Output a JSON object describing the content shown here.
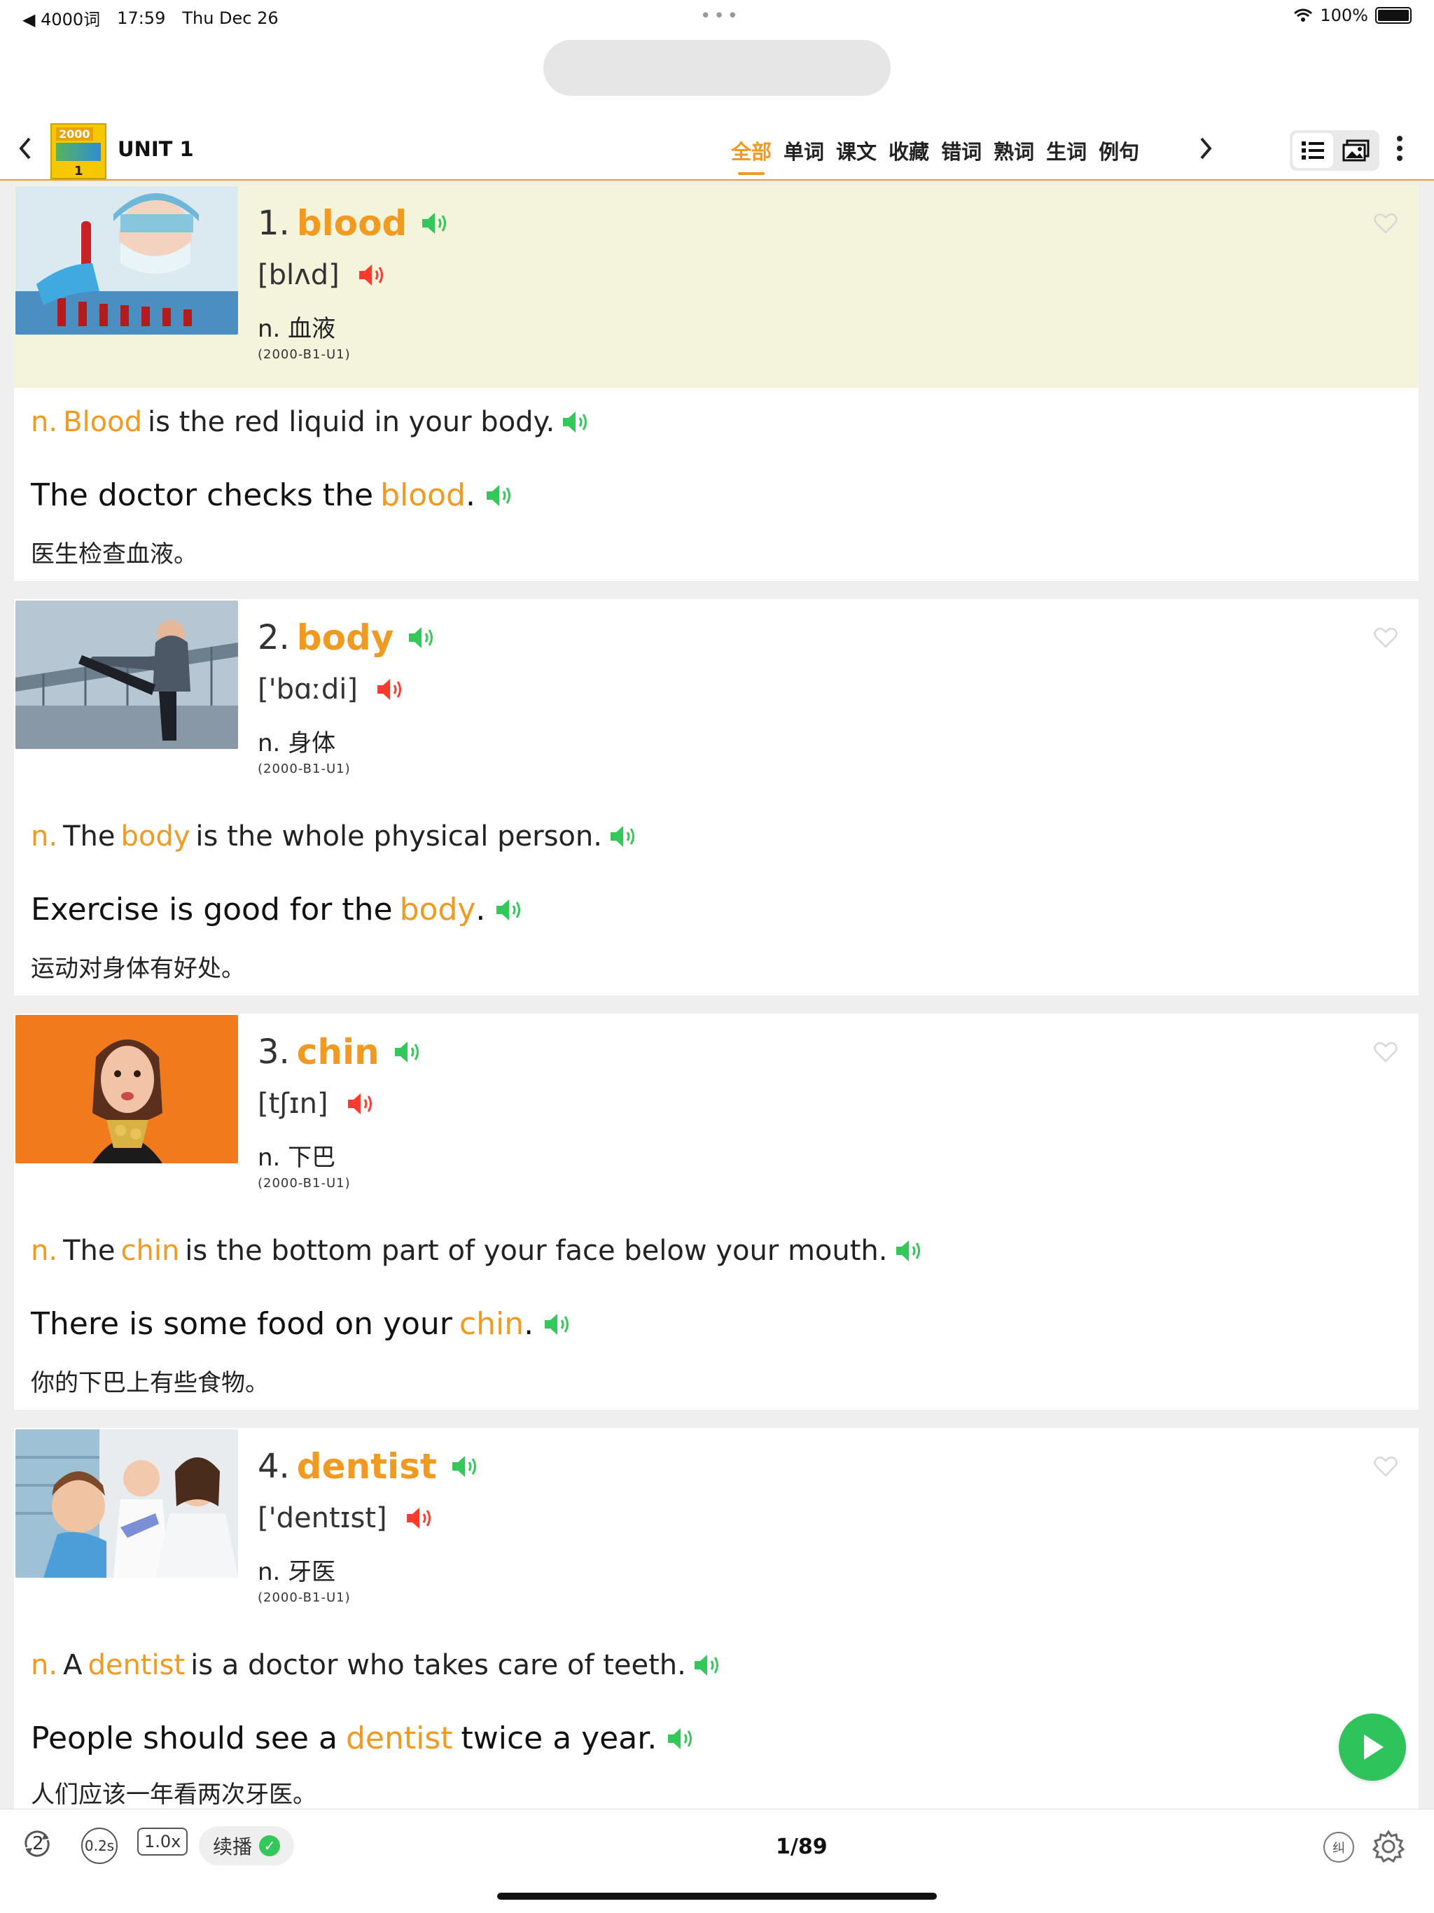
{
  "status_bar": {
    "back_app": "◀ 4000词",
    "time": "17:59",
    "date": "Thu Dec 26",
    "battery": "100%"
  },
  "nav": {
    "unit_title": "UNIT 1",
    "book_cover": {
      "top": "2000",
      "num": "1"
    },
    "tabs": [
      "全部",
      "单词",
      "课文",
      "收藏",
      "错词",
      "熟词",
      "生词",
      "例句"
    ],
    "active_tab": "全部"
  },
  "words": [
    {
      "no": "1.",
      "word": "blood",
      "phonetic": "[blʌd]",
      "meaning": "n. 血液",
      "source": "(2000-B1-U1)",
      "def_pos": "n.",
      "def_pre": "",
      "def_kw": "Blood",
      "def_post": "is the red liquid in your body.",
      "ex_pre": "The doctor checks the",
      "ex_kw": "blood",
      "ex_post": ".",
      "cn": "医生检查血液。"
    },
    {
      "no": "2.",
      "word": "body",
      "phonetic": "['bɑːdi]",
      "meaning": "n. 身体",
      "source": "(2000-B1-U1)",
      "def_pos": "n.",
      "def_pre": "The",
      "def_kw": "body",
      "def_post": "is the whole physical person.",
      "ex_pre": "Exercise is good for the",
      "ex_kw": "body",
      "ex_post": ".",
      "cn": "运动对身体有好处。"
    },
    {
      "no": "3.",
      "word": "chin",
      "phonetic": "[tʃɪn]",
      "meaning": "n. 下巴",
      "source": "(2000-B1-U1)",
      "def_pos": "n.",
      "def_pre": "The",
      "def_kw": "chin",
      "def_post": "is the bottom part of your face below your mouth.",
      "ex_pre": "There is some food on your",
      "ex_kw": "chin",
      "ex_post": ".",
      "cn": "你的下巴上有些食物。"
    },
    {
      "no": "4.",
      "word": "dentist",
      "phonetic": "['dentɪst]",
      "meaning": "n. 牙医",
      "source": "(2000-B1-U1)",
      "def_pos": "n.",
      "def_pre": "A",
      "def_kw": "dentist",
      "def_post": "is a doctor who takes care of teeth.",
      "ex_pre": "People should see a",
      "ex_kw": "dentist",
      "ex_post": "twice a year.",
      "cn": "人们应该一年看两次牙医。"
    }
  ],
  "bottom_bar": {
    "repeat_count": "2",
    "interval": "0.2s",
    "speed": "1.0x",
    "continuous_label": "续播",
    "page_indicator": "1/89",
    "correct_label": "纠"
  },
  "colors": {
    "accent": "#f19a22",
    "speaker_word": "#34c759",
    "speaker_phonetic": "#ff3b30",
    "highlight_bg": "#f4f3dc",
    "play": "#2fc35b"
  },
  "icons": {
    "word_speaker": "speaker-green-icon",
    "phonetic_speaker": "speaker-red-icon",
    "favorite": "heart-outline-icon",
    "play": "play-icon",
    "settings": "gear-icon"
  }
}
